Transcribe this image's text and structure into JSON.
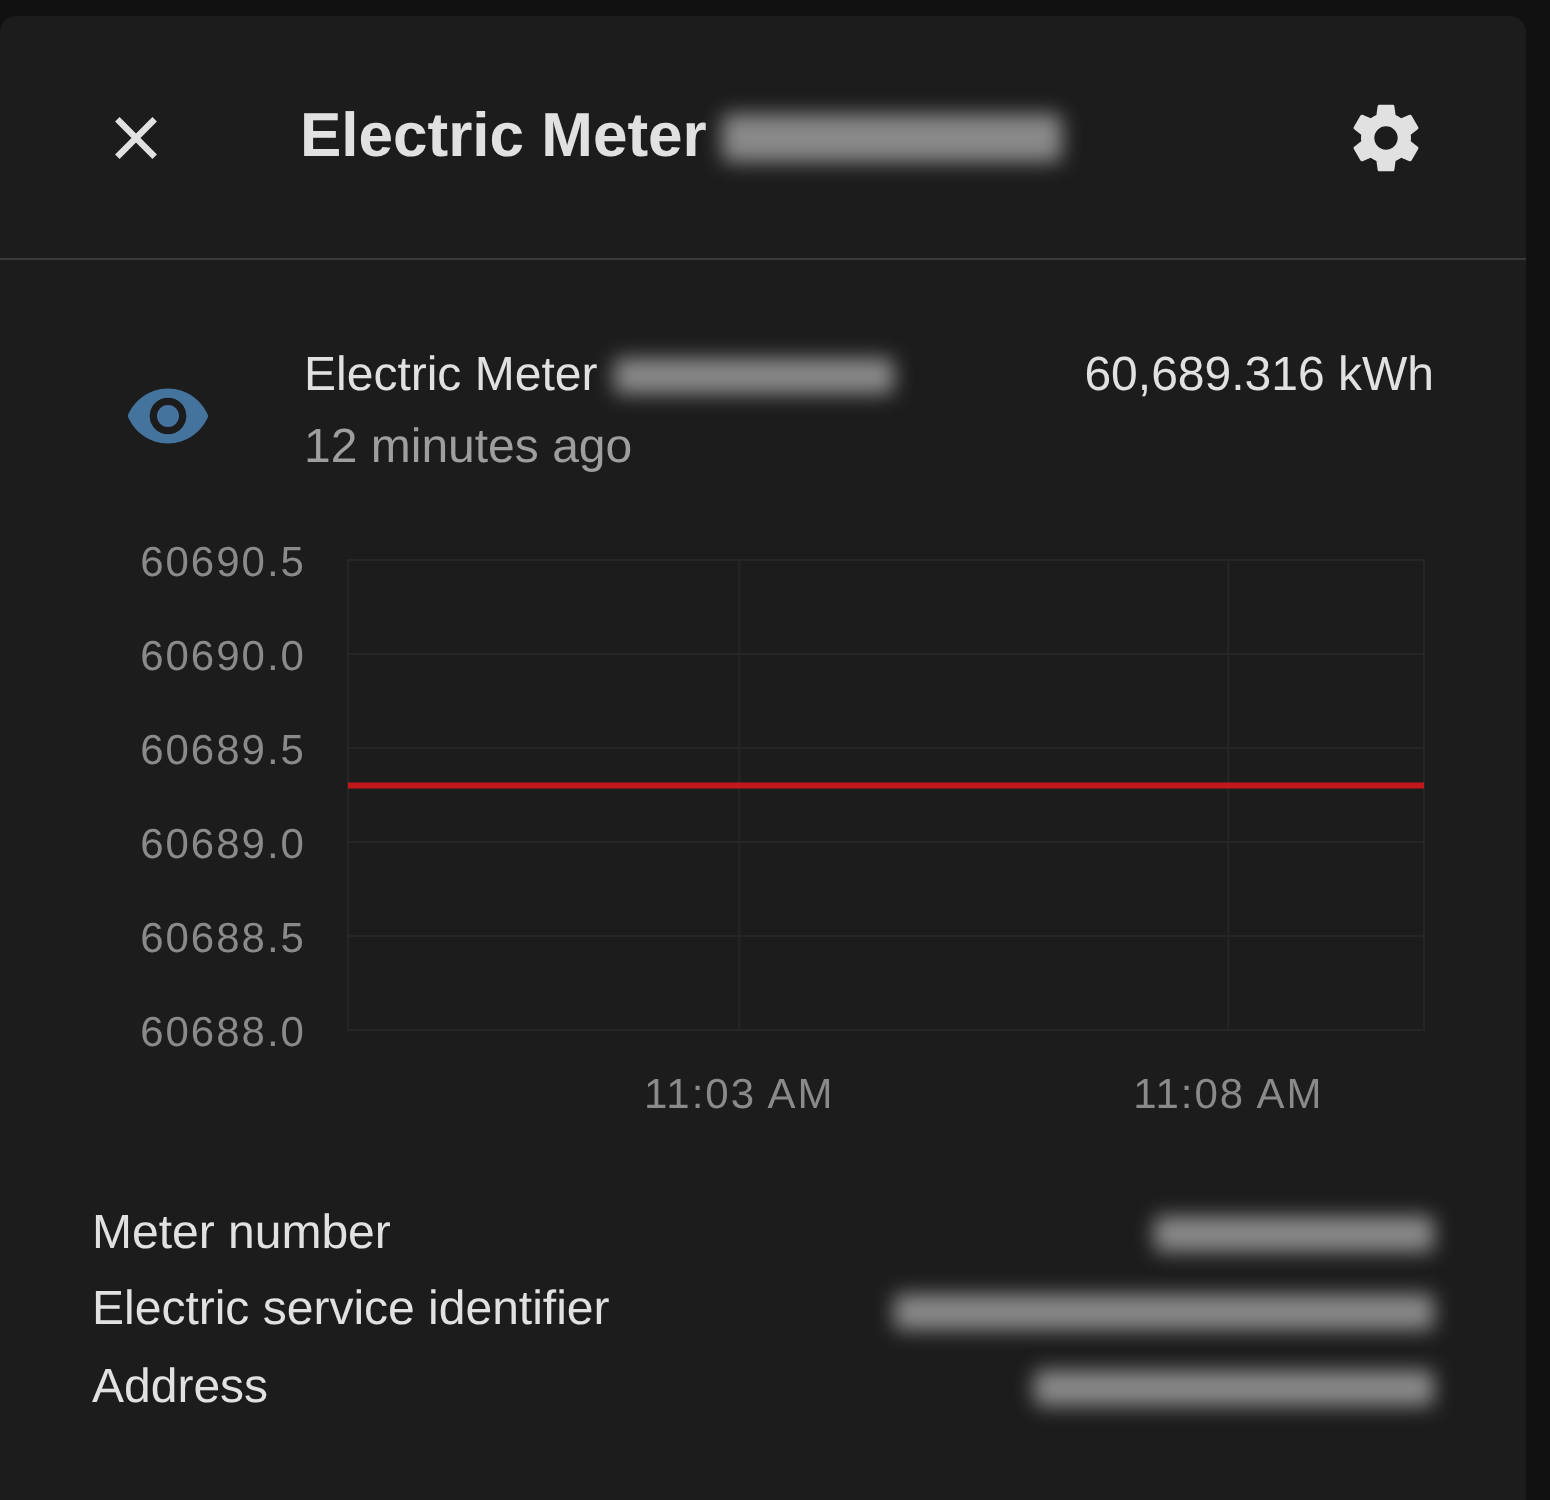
{
  "dialog": {
    "title": "Electric Meter"
  },
  "entity": {
    "name": "Electric Meter",
    "state": "60,689.316 kWh",
    "last_changed": "12 minutes ago"
  },
  "chart_data": {
    "type": "line",
    "categories": [
      null,
      null,
      null,
      null,
      "11:03 AM",
      null,
      null,
      null,
      null,
      "11:08 AM",
      null,
      null
    ],
    "ylim": [
      60688.0,
      60690.5
    ],
    "grid": true,
    "yticks": [
      {
        "value": 60688.0,
        "label": "60688.0"
      },
      {
        "value": 60688.5,
        "label": "60688.5"
      },
      {
        "value": 60689.0,
        "label": "60689.0"
      },
      {
        "value": 60689.5,
        "label": "60689.5"
      },
      {
        "value": 60690.0,
        "label": "60690.0"
      },
      {
        "value": 60690.5,
        "label": "60690.5"
      }
    ],
    "series": [
      {
        "color": "#c2181b",
        "values": [
          60689.3,
          60689.3,
          60689.3,
          60689.3,
          60689.3,
          60689.3,
          60689.3,
          60689.3,
          60689.3,
          60689.3,
          60689.3,
          60689.3
        ]
      }
    ]
  },
  "attributes": [
    {
      "label": "Meter number"
    },
    {
      "label": "Electric service identifier"
    },
    {
      "label": "Address"
    }
  ]
}
